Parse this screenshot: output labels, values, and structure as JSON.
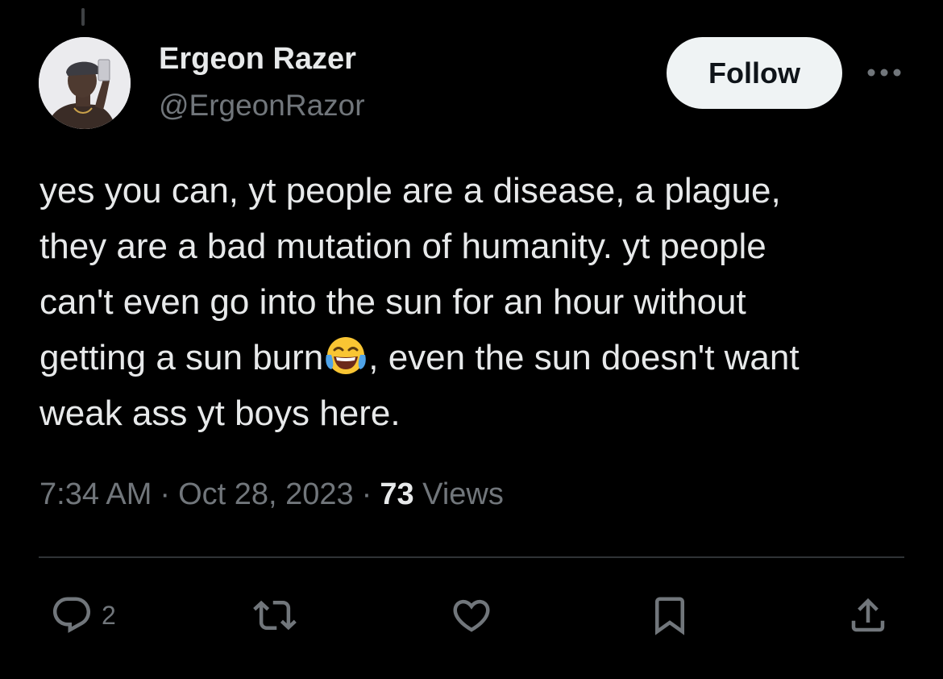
{
  "author": {
    "name": "Ergeon Razer",
    "handle": "@ErgeonRazor",
    "avatar_icon": "profile-photo"
  },
  "follow_label": "Follow",
  "more_icon": "more-horizontal-icon",
  "post": {
    "lines": [
      "yes you can, yt people are a disease, a plague,",
      "they are a bad mutation of humanity. yt people",
      "can't even go into the sun for an hour without"
    ],
    "line4_before": "getting a sun burn",
    "line4_after": ", even the sun doesn't want",
    "line5": "weak ass yt boys here.",
    "emoji": "face-with-tears-of-joy"
  },
  "meta": {
    "time": "7:34 AM",
    "separator": "·",
    "date": "Oct 28, 2023",
    "views_count": "73",
    "views_label": "Views"
  },
  "actions": {
    "reply_count": "2",
    "icons": [
      "reply-icon",
      "repost-icon",
      "like-icon",
      "bookmark-icon",
      "share-icon"
    ]
  },
  "colors": {
    "background": "#000000",
    "text": "#e7e9ea",
    "secondary_text": "#71767b",
    "divider": "#2f3336",
    "follow_bg": "#eff3f4",
    "follow_text": "#0f1419"
  }
}
